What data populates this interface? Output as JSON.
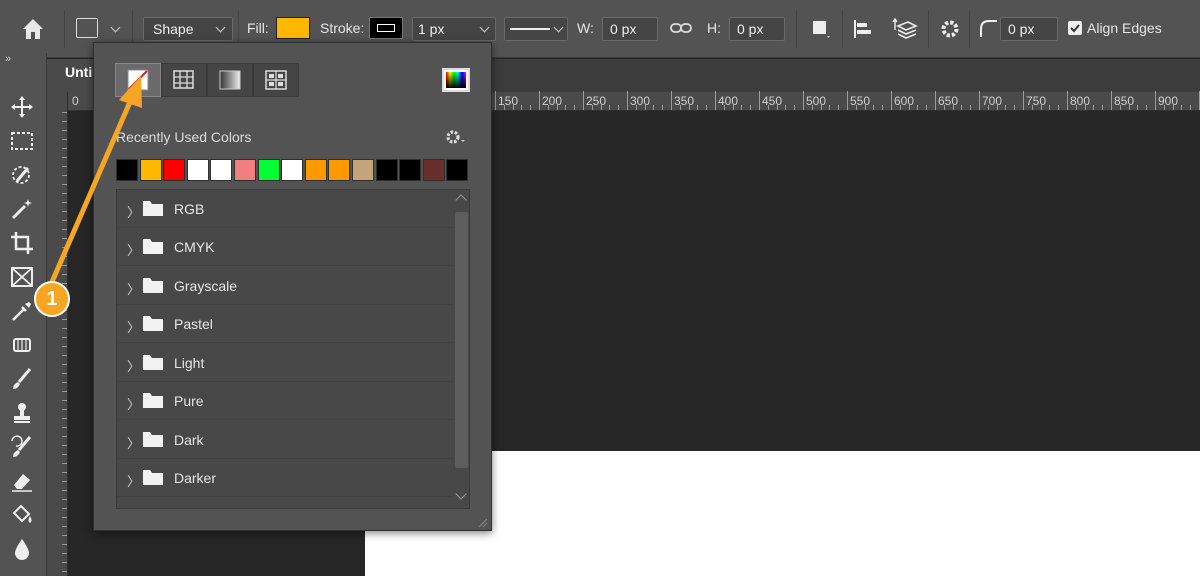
{
  "options_bar": {
    "tool_mode": "Shape",
    "fill_label": "Fill:",
    "fill_color": "#FFB800",
    "stroke_label": "Stroke:",
    "stroke_width": "1 px",
    "w_label": "W:",
    "w_value": "0 px",
    "h_label": "H:",
    "h_value": "0 px",
    "radius_value": "0 px",
    "align_edges_label": "Align Edges",
    "align_edges_checked": true
  },
  "document_tab": {
    "title": "Unti"
  },
  "ruler": {
    "h_ticks": [
      "0",
      "150",
      "200",
      "250",
      "300",
      "350",
      "400",
      "450",
      "500",
      "550",
      "600",
      "650",
      "700",
      "750",
      "800",
      "850",
      "900"
    ]
  },
  "color_picker": {
    "recent_label": "Recently Used Colors",
    "recent_colors": [
      "#000000",
      "#FFB800",
      "#FF0000",
      "#FFFFFF",
      "#FFFFFF",
      "#F08080",
      "#00FF33",
      "#FFFFFF",
      "#FF9900",
      "#FF9900",
      "#C4A57A",
      "#000000",
      "#000000",
      "#6B2E2E",
      "#000000"
    ],
    "folders": [
      "RGB",
      "CMYK",
      "Grayscale",
      "Pastel",
      "Light",
      "Pure",
      "Dark",
      "Darker"
    ]
  },
  "annotation": {
    "step_number": "1",
    "color": "#F5A623"
  }
}
